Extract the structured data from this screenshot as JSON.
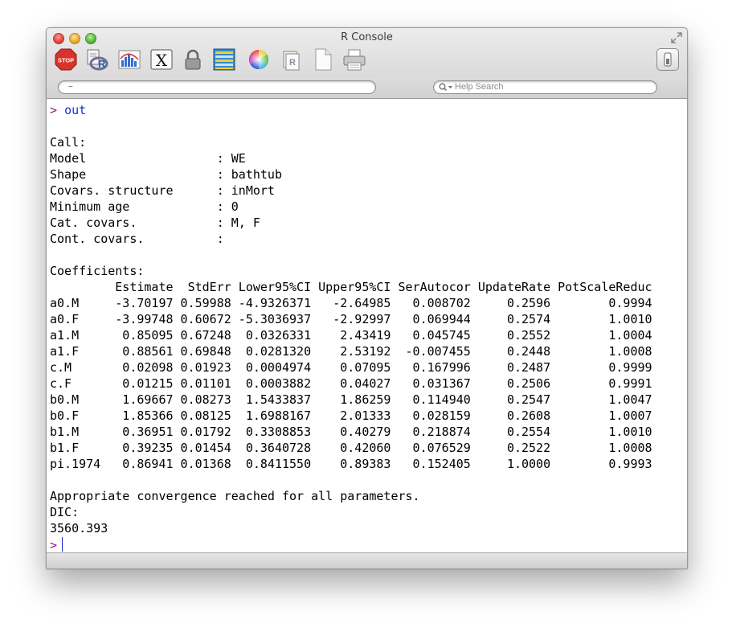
{
  "window": {
    "title": "R Console"
  },
  "toolbar": {
    "icons": [
      "stop-icon",
      "source-script-icon",
      "quartz-plot-icon",
      "x11-icon",
      "lock-icon",
      "data-editor-icon",
      "color-wheel-icon",
      "package-manager-icon",
      "new-document-icon",
      "print-icon"
    ],
    "stop_label": "STOP"
  },
  "search": {
    "path_value": "~",
    "help_placeholder": "Help Search"
  },
  "console": {
    "prompt_char": ">",
    "command": "out",
    "output": "\nCall:\nModel                  : WE\nShape                  : bathtub\nCovars. structure      : inMort\nMinimum age            : 0\nCat. covars.           : M, F\nCont. covars.          : \n\nCoefficients:\n         Estimate  StdErr Lower95%CI Upper95%CI SerAutocor UpdateRate PotScaleReduc\na0.M     -3.70197 0.59988 -4.9326371   -2.64985   0.008702     0.2596        0.9994\na0.F     -3.99748 0.60672 -5.3036937   -2.92997   0.069944     0.2574        1.0010\na1.M      0.85095 0.67248  0.0326331    2.43419   0.045745     0.2552        1.0004\na1.F      0.88561 0.69848  0.0281320    2.53192  -0.007455     0.2448        1.0008\nc.M       0.02098 0.01923  0.0004974    0.07095   0.167996     0.2487        0.9999\nc.F       0.01215 0.01101  0.0003882    0.04027   0.031367     0.2506        0.9991\nb0.M      1.69667 0.08273  1.5433837    1.86259   0.114940     0.2547        1.0047\nb0.F      1.85366 0.08125  1.6988167    2.01333   0.028159     0.2608        1.0007\nb1.M      0.36951 0.01792  0.3308853    0.40279   0.218874     0.2554        1.0010\nb1.F      0.39235 0.01454  0.3640728    0.42060   0.076529     0.2522        1.0008\npi.1974   0.86941 0.01368  0.8411550    0.89383   0.152405     1.0000        0.9993\n\nAppropriate convergence reached for all parameters.\nDIC:\n3560.393",
    "cursor_prompt": ">"
  },
  "colors": {
    "prompt": "#8b1a8b",
    "command": "#1c2cd6"
  }
}
